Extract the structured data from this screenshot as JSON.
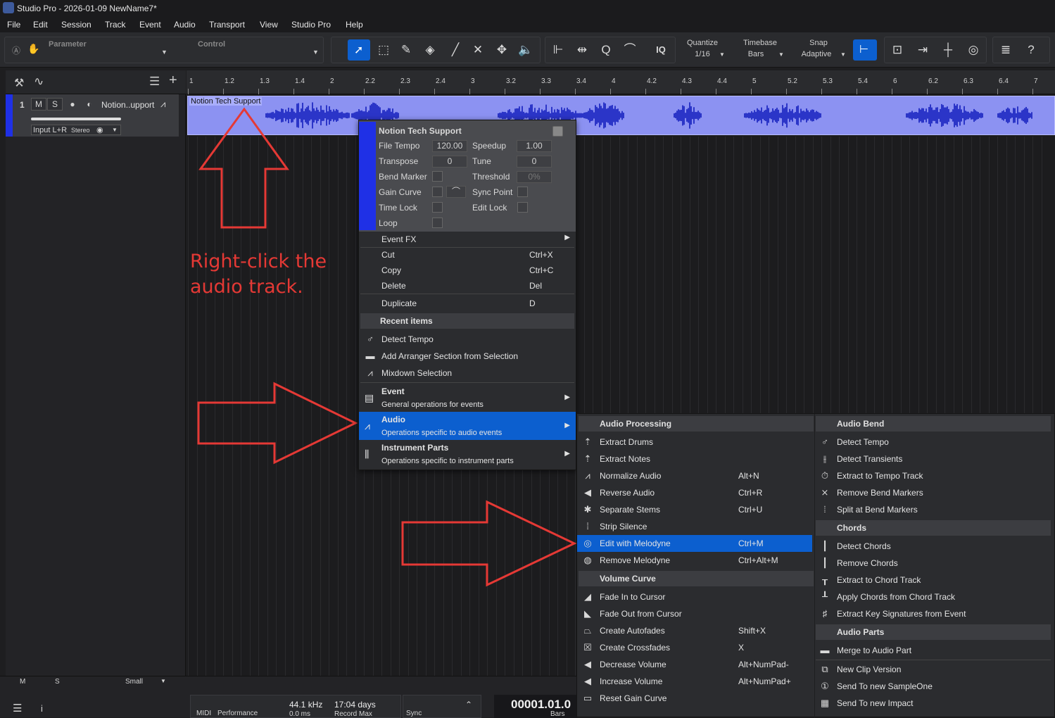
{
  "window": {
    "title": "Studio Pro - 2026-01-09 NewName7*"
  },
  "menubar": [
    "File",
    "Edit",
    "Session",
    "Track",
    "Event",
    "Audio",
    "Transport",
    "View",
    "Studio Pro",
    "Help"
  ],
  "toolbar": {
    "parameter": "Parameter",
    "control": "Control",
    "quantize_label": "Quantize",
    "quantize_value": "1/16",
    "timebase_label": "Timebase",
    "timebase_value": "Bars",
    "snap_label": "Snap",
    "snap_value": "Adaptive",
    "iq": "IQ"
  },
  "track": {
    "number": "1",
    "mute": "M",
    "solo": "S",
    "name": "Notion..upport",
    "input": "Input L+R",
    "channel": "Stereo"
  },
  "ruler": [
    "1",
    "1.2",
    "1.3",
    "1.4",
    "2",
    "2.2",
    "2.3",
    "2.4",
    "3",
    "3.2",
    "3.3",
    "3.4",
    "4",
    "4.2",
    "4.3",
    "4.4",
    "5",
    "5.2",
    "5.3",
    "5.4",
    "6",
    "6.2",
    "6.3",
    "6.4",
    "7"
  ],
  "clip": {
    "name": "Notion Tech Support"
  },
  "annotation": {
    "line1": "Right-click the",
    "line2": "audio track."
  },
  "context_menu": {
    "header": {
      "title": "Notion Tech Support",
      "file_tempo_label": "File Tempo",
      "file_tempo": "120.00",
      "speedup_label": "Speedup",
      "speedup": "1.00",
      "transpose_label": "Transpose",
      "transpose": "0",
      "tune_label": "Tune",
      "tune": "0",
      "bend_marker": "Bend Marker",
      "threshold_label": "Threshold",
      "threshold": "0%",
      "gain_curve": "Gain Curve",
      "sync_point": "Sync Point",
      "time_lock": "Time Lock",
      "edit_lock": "Edit Lock",
      "loop": "Loop"
    },
    "items": [
      {
        "label": "Event FX",
        "shortcut": ""
      },
      {
        "label": "Cut",
        "shortcut": "Ctrl+X"
      },
      {
        "label": "Copy",
        "shortcut": "Ctrl+C"
      },
      {
        "label": "Delete",
        "shortcut": "Del"
      },
      {
        "label": "Duplicate",
        "shortcut": "D"
      }
    ],
    "recent_title": "Recent items",
    "recent": [
      "Detect Tempo",
      "Add Arranger Section from Selection",
      "Mixdown Selection"
    ],
    "groups": [
      {
        "title": "Event",
        "subtitle": "General operations for events"
      },
      {
        "title": "Audio",
        "subtitle": "Operations specific to audio events"
      },
      {
        "title": "Instrument Parts",
        "subtitle": "Operations specific to instrument parts"
      }
    ]
  },
  "submenu": {
    "left": {
      "processing_title": "Audio Processing",
      "processing": [
        {
          "label": "Extract Drums",
          "shortcut": ""
        },
        {
          "label": "Extract Notes",
          "shortcut": ""
        },
        {
          "label": "Normalize Audio",
          "shortcut": "Alt+N"
        },
        {
          "label": "Reverse Audio",
          "shortcut": "Ctrl+R"
        },
        {
          "label": "Separate Stems",
          "shortcut": "Ctrl+U"
        },
        {
          "label": "Strip Silence",
          "shortcut": ""
        },
        {
          "label": "Edit with Melodyne",
          "shortcut": "Ctrl+M"
        },
        {
          "label": "Remove Melodyne",
          "shortcut": "Ctrl+Alt+M"
        }
      ],
      "volume_title": "Volume Curve",
      "volume": [
        {
          "label": "Fade In to Cursor",
          "shortcut": ""
        },
        {
          "label": "Fade Out from Cursor",
          "shortcut": ""
        },
        {
          "label": "Create Autofades",
          "shortcut": "Shift+X"
        },
        {
          "label": "Create Crossfades",
          "shortcut": "X"
        },
        {
          "label": "Decrease Volume",
          "shortcut": "Alt+NumPad-"
        },
        {
          "label": "Increase Volume",
          "shortcut": "Alt+NumPad+"
        },
        {
          "label": "Reset Gain Curve",
          "shortcut": ""
        }
      ]
    },
    "right": {
      "bend_title": "Audio Bend",
      "bend": [
        "Detect Tempo",
        "Detect Transients",
        "Extract to Tempo Track",
        "Remove Bend Markers",
        "Split at Bend Markers"
      ],
      "chords_title": "Chords",
      "chords": [
        "Detect Chords",
        "Remove Chords",
        "Extract to Chord Track",
        "Apply Chords from Chord Track",
        "Extract Key Signatures from Event"
      ],
      "parts_title": "Audio Parts",
      "parts": [
        "Merge to Audio Part",
        "New Clip Version",
        "Send To new SampleOne",
        "Send To new Impact"
      ]
    }
  },
  "bottom": {
    "m": "M",
    "s": "S",
    "size": "Small",
    "sample_rate": "44.1 kHz",
    "ms": "0.0 ms",
    "days": "17:04 days",
    "record_max": "Record Max",
    "midi": "MIDI",
    "performance": "Performance",
    "sync": "Sync",
    "position": "00001.01.0",
    "bars": "Bars"
  },
  "colors": {
    "accent": "#0c5fcf",
    "clip": "#8c92f2",
    "arrow": "#e53935"
  }
}
